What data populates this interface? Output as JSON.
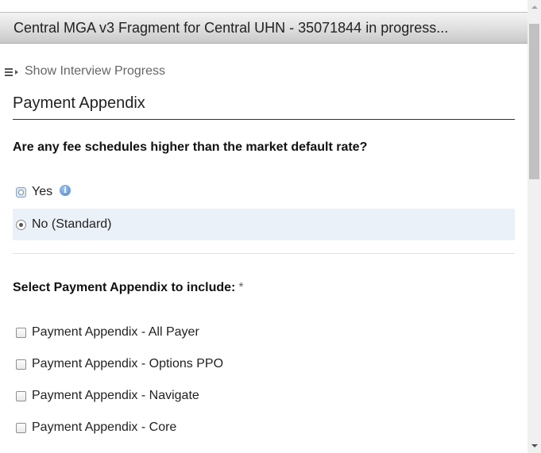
{
  "header": {
    "title": "Central MGA v3 Fragment for Central UHN - 35071844 in progress..."
  },
  "progress_toggle": {
    "label": "Show Interview Progress"
  },
  "section": {
    "title": "Payment Appendix"
  },
  "question_fee": {
    "text": "Are any fee schedules higher than the market default rate?",
    "options": [
      {
        "label": "Yes",
        "selected": false
      },
      {
        "label": "No (Standard)",
        "selected": true
      }
    ]
  },
  "question_appendix": {
    "text": "Select Payment Appendix to include:",
    "required_mark": "*",
    "options": [
      {
        "label": "Payment Appendix - All Payer",
        "checked": false
      },
      {
        "label": "Payment Appendix - Options PPO",
        "checked": false
      },
      {
        "label": "Payment Appendix - Navigate",
        "checked": false
      },
      {
        "label": "Payment Appendix - Core",
        "checked": false
      }
    ]
  },
  "icons": {
    "info": "info-icon",
    "menu": "menu-expand-icon"
  },
  "colors": {
    "selected_row": "#ebf1f8",
    "info_icon": "#4f86c6"
  }
}
